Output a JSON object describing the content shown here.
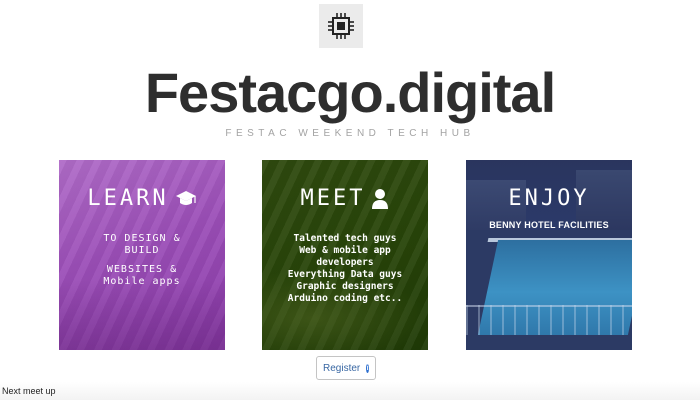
{
  "logo": {
    "icon": "cpu-chip-icon"
  },
  "header": {
    "title": "Festacgo.digital",
    "tagline": "FESTAC WEEKEND TECH HUB"
  },
  "cards": {
    "learn": {
      "heading": "LEARN",
      "icon": "graduation-cap-icon",
      "lines": [
        "TO DESIGN &",
        "BUILD",
        "WEBSITES &",
        "Mobile apps"
      ]
    },
    "meet": {
      "heading": "MEET",
      "icon": "user-icon",
      "lines": [
        "Talented tech guys",
        "Web & mobile app",
        "developers",
        "Everything Data guys",
        "Graphic designers",
        "Arduino coding etc.."
      ]
    },
    "enjoy": {
      "heading": "ENJOY",
      "subtitle": "BENNY HOTEL FACILITIES"
    }
  },
  "register_button": {
    "label": "Register",
    "icon": "info-icon"
  },
  "footer": {
    "text": "Next meet up"
  },
  "colors": {
    "title": "#2e2e2e",
    "tagline": "#a3a3a3",
    "learn_bg": "#9c4fb8",
    "meet_bg": "#284509",
    "enjoy_bg": "#20305e",
    "button_text": "#3867a3",
    "info_icon": "#2d6fcf"
  }
}
